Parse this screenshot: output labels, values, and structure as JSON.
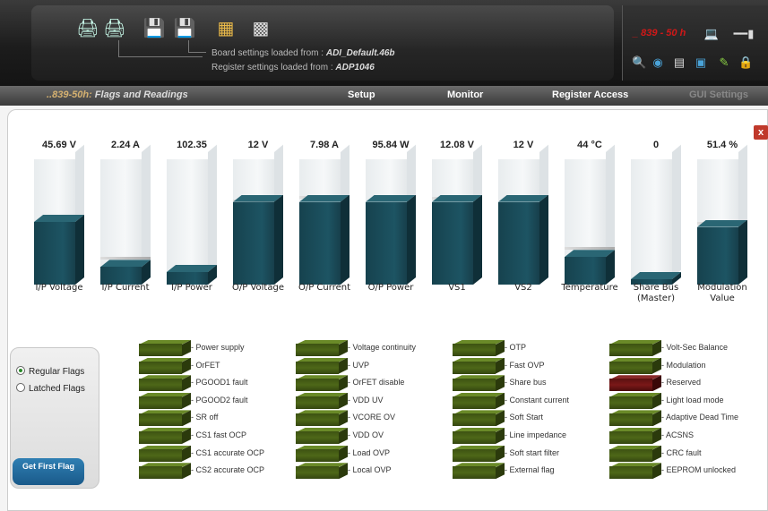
{
  "header": {
    "board_prefix": "Board settings loaded from : ",
    "board_file": "ADI_Default.46b",
    "register_prefix": "Register settings loaded from : ",
    "register_file": "ADP1046",
    "device_name": "_ 839 - 50 h"
  },
  "nav": {
    "title_prefix": "..839-50h:",
    "title_text": " Flags and Readings",
    "setup": "Setup",
    "monitor": "Monitor",
    "register_access": "Register Access",
    "gui_settings": "GUI Settings"
  },
  "close_label": "x",
  "meters": [
    {
      "label": "I/P Voltage",
      "value": "45.69 V",
      "fill": 0.5,
      "mark": null
    },
    {
      "label": "I/P Current",
      "value": "2.24 A",
      "fill": 0.14,
      "mark": 0.22
    },
    {
      "label": "I/P Power",
      "value": "102.35",
      "fill": 0.1,
      "mark": null
    },
    {
      "label": "O/P Voltage",
      "value": "12 V",
      "fill": 0.66,
      "mark": 0.68
    },
    {
      "label": "O/P Current",
      "value": "7.98 A",
      "fill": 0.66,
      "mark": 0.71
    },
    {
      "label": "O/P Power",
      "value": "95.84 W",
      "fill": 0.66,
      "mark": null
    },
    {
      "label": "VS1",
      "value": "12.08 V",
      "fill": 0.66,
      "mark": 0.7
    },
    {
      "label": "VS2",
      "value": "12 V",
      "fill": 0.66,
      "mark": null
    },
    {
      "label": "Temperature",
      "value": "44 °C",
      "fill": 0.22,
      "mark": 0.3
    },
    {
      "label": "Share Bus\n(Master)",
      "value": "0",
      "fill": 0.0,
      "mark": null
    },
    {
      "label": "Modulation\nValue",
      "value": "51.4 %",
      "fill": 0.46,
      "mark": 0.5
    }
  ],
  "mode": {
    "regular": "Regular Flags",
    "latched": "Latched Flags",
    "selected": "regular",
    "button": "Get First Flag"
  },
  "flag_columns": [
    [
      {
        "name": "- Power supply",
        "state": "green"
      },
      {
        "name": "- OrFET",
        "state": "green"
      },
      {
        "name": "- PGOOD1 fault",
        "state": "green"
      },
      {
        "name": "- PGOOD2 fault",
        "state": "green"
      },
      {
        "name": "- SR off",
        "state": "green"
      },
      {
        "name": "- CS1 fast OCP",
        "state": "green"
      },
      {
        "name": "- CS1 accurate OCP",
        "state": "green"
      },
      {
        "name": "- CS2 accurate OCP",
        "state": "green"
      }
    ],
    [
      {
        "name": "- Voltage continuity",
        "state": "green"
      },
      {
        "name": "- UVP",
        "state": "green"
      },
      {
        "name": "- OrFET disable",
        "state": "green"
      },
      {
        "name": "- VDD UV",
        "state": "green"
      },
      {
        "name": "- VCORE OV",
        "state": "green"
      },
      {
        "name": "- VDD OV",
        "state": "green"
      },
      {
        "name": "- Load OVP",
        "state": "green"
      },
      {
        "name": "- Local OVP",
        "state": "green"
      }
    ],
    [
      {
        "name": "- OTP",
        "state": "green"
      },
      {
        "name": "- Fast OVP",
        "state": "green"
      },
      {
        "name": "- Share bus",
        "state": "green"
      },
      {
        "name": "- Constant current",
        "state": "green"
      },
      {
        "name": "- Soft Start",
        "state": "green"
      },
      {
        "name": "- Line impedance",
        "state": "green"
      },
      {
        "name": "- Soft start filter",
        "state": "green"
      },
      {
        "name": "- External flag",
        "state": "green"
      }
    ],
    [
      {
        "name": "- Volt-Sec Balance",
        "state": "green"
      },
      {
        "name": "- Modulation",
        "state": "green"
      },
      {
        "name": "- Reserved",
        "state": "red"
      },
      {
        "name": "- Light load mode",
        "state": "green"
      },
      {
        "name": "- Adaptive Dead Time",
        "state": "green"
      },
      {
        "name": "- ACSNS",
        "state": "green"
      },
      {
        "name": "- CRC fault",
        "state": "green"
      },
      {
        "name": "- EEPROM unlocked",
        "state": "green"
      }
    ]
  ]
}
